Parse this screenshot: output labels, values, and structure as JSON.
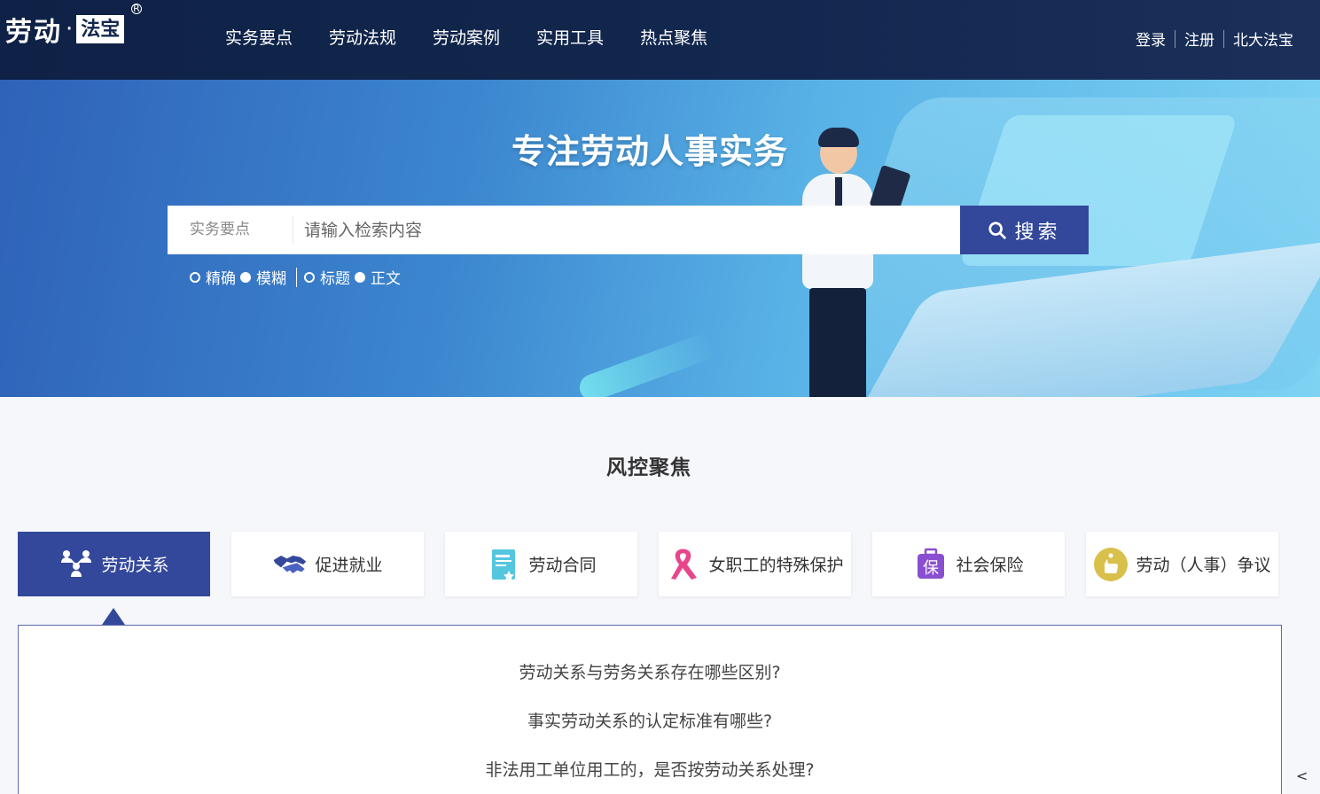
{
  "header": {
    "logo_text": "劳动",
    "logo_dot": "·",
    "logo_box_text": "法宝",
    "logo_reg": "R",
    "nav": [
      "实务要点",
      "劳动法规",
      "劳动案例",
      "实用工具",
      "热点聚焦"
    ],
    "login": "登录",
    "register": "注册",
    "pkulaw": "北大法宝"
  },
  "banner": {
    "title": "专注劳动人事实务",
    "search_category": "实务要点",
    "search_placeholder": "请输入检索内容",
    "search_button": "搜索",
    "options": [
      "精确",
      "模糊",
      "标题",
      "正文"
    ]
  },
  "section": {
    "title": "风控聚焦",
    "tabs": [
      {
        "label": "劳动关系",
        "icon": "people-network-icon",
        "active": true
      },
      {
        "label": "促进就业",
        "icon": "handshake-icon",
        "active": false
      },
      {
        "label": "劳动合同",
        "icon": "contract-doc-icon",
        "active": false
      },
      {
        "label": "女职工的特殊保护",
        "icon": "pink-ribbon-icon",
        "active": false
      },
      {
        "label": "社会保险",
        "icon": "insurance-bag-icon",
        "active": false
      },
      {
        "label": "劳动（人事）争议",
        "icon": "dispute-hand-icon",
        "active": false
      }
    ],
    "questions": [
      "劳动关系与劳务关系存在哪些区别?",
      "事实劳动关系的认定标准有哪些?",
      "非法用工单位用工的，是否按劳动关系处理?"
    ]
  },
  "scroll_button": "<",
  "colors": {
    "header_bg": "#13284f",
    "accent": "#33489a",
    "pink": "#e8468a",
    "purple": "#8a4fd1",
    "teal": "#55c6e0",
    "gold": "#d9c04b"
  }
}
